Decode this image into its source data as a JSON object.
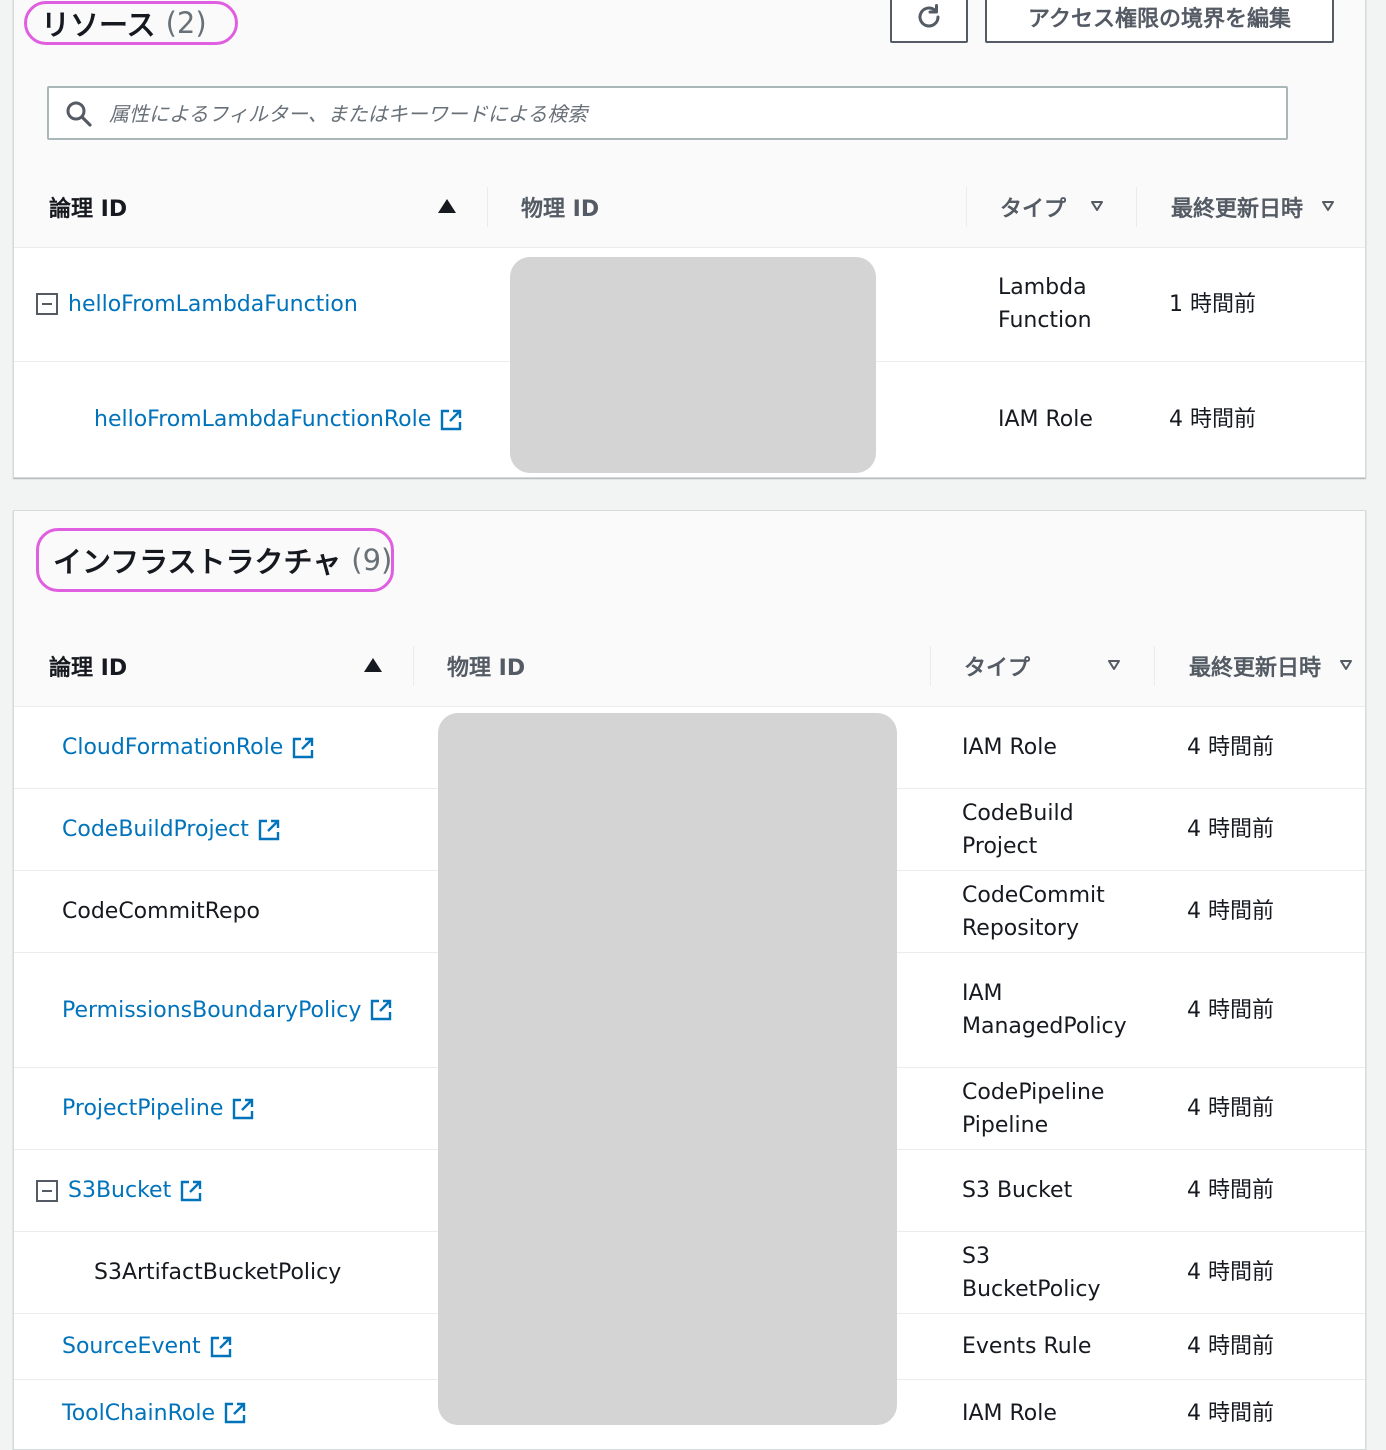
{
  "resources": {
    "title": "リソース",
    "count": "(2)",
    "refresh_icon": "refresh-icon",
    "boundary_button_label": "アクセス権限の境界を編集",
    "search_placeholder": "属性によるフィルター、またはキーワードによる検索",
    "columns": [
      "論理 ID",
      "物理 ID",
      "タイプ",
      "最終更新日時"
    ],
    "rows": [
      {
        "logical_id": "helloFromLambdaFunction",
        "type_line1": "Lambda",
        "type_line2": "Function",
        "updated": "1 時間前"
      },
      {
        "logical_id": "helloFromLambdaFunctionRole",
        "type_line1": "IAM Role",
        "type_line2": "",
        "updated": "4 時間前"
      }
    ]
  },
  "infrastructure": {
    "title": "インフラストラクチャ",
    "count": "(9)",
    "columns": [
      "論理 ID",
      "物理 ID",
      "タイプ",
      "最終更新日時"
    ],
    "rows": [
      {
        "logical_id": "CloudFormationRole",
        "type_line1": "IAM Role",
        "type_line2": "",
        "updated": "4 時間前"
      },
      {
        "logical_id": "CodeBuildProject",
        "type_line1": "CodeBuild",
        "type_line2": "Project",
        "updated": "4 時間前"
      },
      {
        "logical_id": "CodeCommitRepo",
        "type_line1": "CodeCommit",
        "type_line2": "Repository",
        "updated": "4 時間前"
      },
      {
        "logical_id": "PermissionsBoundaryPolicy",
        "type_line1": "IAM",
        "type_line2": "ManagedPolicy",
        "updated": "4 時間前"
      },
      {
        "logical_id": "ProjectPipeline",
        "type_line1": "CodePipeline",
        "type_line2": "Pipeline",
        "updated": "4 時間前"
      },
      {
        "logical_id": "S3Bucket",
        "type_line1": "S3 Bucket",
        "type_line2": "",
        "updated": "4 時間前"
      },
      {
        "logical_id": "S3ArtifactBucketPolicy",
        "type_line1": "S3",
        "type_line2": "BucketPolicy",
        "updated": "4 時間前"
      },
      {
        "logical_id": "SourceEvent",
        "type_line1": "Events Rule",
        "type_line2": "",
        "updated": "4 時間前"
      },
      {
        "logical_id": "ToolChainRole",
        "type_line1": "IAM Role",
        "type_line2": "",
        "updated": "4 時間前"
      }
    ]
  },
  "colors": {
    "link": "#0073bb",
    "highlight": "#e05ee0",
    "redaction": "#d4d4d4"
  }
}
